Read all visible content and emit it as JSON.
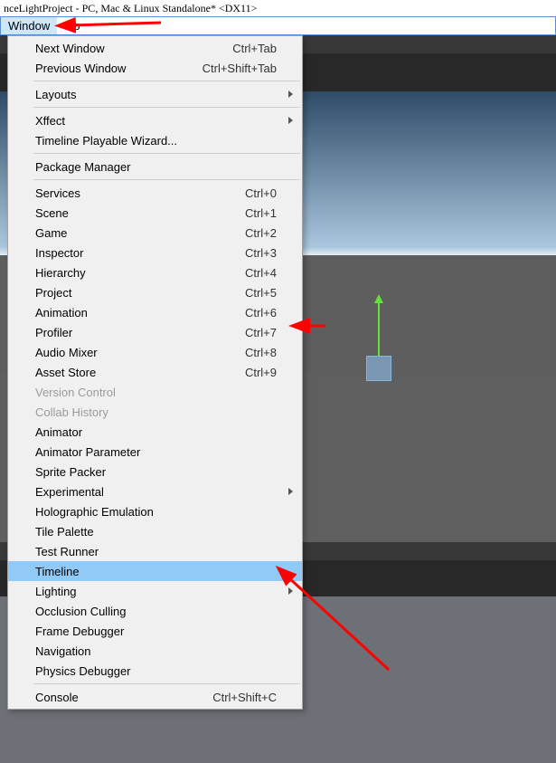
{
  "title": "nceLightProject - PC, Mac & Linux Standalone* <DX11>",
  "menubar": {
    "window": "Window",
    "help": "elp"
  },
  "dropdown": {
    "next_window": {
      "label": "Next Window",
      "shortcut": "Ctrl+Tab"
    },
    "previous_window": {
      "label": "Previous Window",
      "shortcut": "Ctrl+Shift+Tab"
    },
    "layouts": {
      "label": "Layouts"
    },
    "xffect": {
      "label": "Xffect"
    },
    "timeline_wizard": {
      "label": "Timeline Playable Wizard..."
    },
    "package_manager": {
      "label": "Package Manager"
    },
    "services": {
      "label": "Services",
      "shortcut": "Ctrl+0"
    },
    "scene": {
      "label": "Scene",
      "shortcut": "Ctrl+1"
    },
    "game": {
      "label": "Game",
      "shortcut": "Ctrl+2"
    },
    "inspector": {
      "label": "Inspector",
      "shortcut": "Ctrl+3"
    },
    "hierarchy": {
      "label": "Hierarchy",
      "shortcut": "Ctrl+4"
    },
    "project": {
      "label": "Project",
      "shortcut": "Ctrl+5"
    },
    "animation": {
      "label": "Animation",
      "shortcut": "Ctrl+6"
    },
    "profiler": {
      "label": "Profiler",
      "shortcut": "Ctrl+7"
    },
    "audio_mixer": {
      "label": "Audio Mixer",
      "shortcut": "Ctrl+8"
    },
    "asset_store": {
      "label": "Asset Store",
      "shortcut": "Ctrl+9"
    },
    "version_control": {
      "label": "Version Control"
    },
    "collab_history": {
      "label": "Collab History"
    },
    "animator": {
      "label": "Animator"
    },
    "animator_parameter": {
      "label": "Animator Parameter"
    },
    "sprite_packer": {
      "label": "Sprite Packer"
    },
    "experimental": {
      "label": "Experimental"
    },
    "holographic": {
      "label": "Holographic Emulation"
    },
    "tile_palette": {
      "label": "Tile Palette"
    },
    "test_runner": {
      "label": "Test Runner"
    },
    "timeline": {
      "label": "Timeline"
    },
    "lighting": {
      "label": "Lighting"
    },
    "occlusion": {
      "label": "Occlusion Culling"
    },
    "frame_debugger": {
      "label": "Frame Debugger"
    },
    "navigation": {
      "label": "Navigation"
    },
    "physics_debugger": {
      "label": "Physics Debugger"
    },
    "console": {
      "label": "Console",
      "shortcut": "Ctrl+Shift+C"
    }
  }
}
